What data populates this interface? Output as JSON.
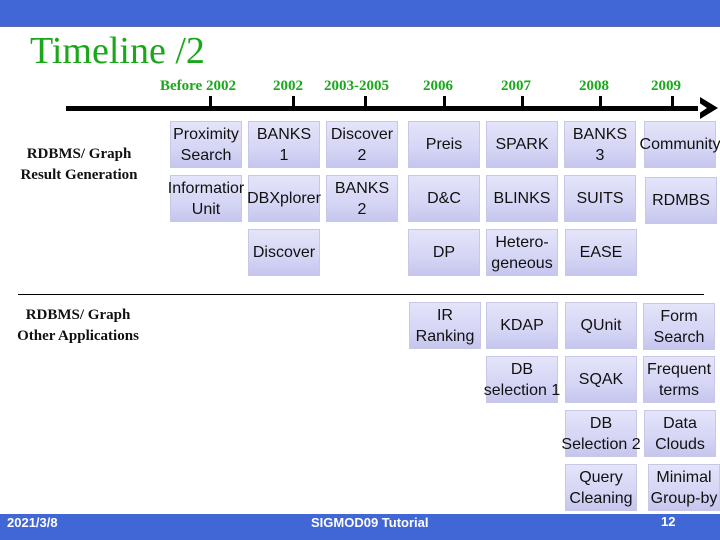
{
  "slide": {
    "title": "Timeline /2",
    "footer": {
      "date": "2021/3/8",
      "center": "SIGMOD09 Tutorial",
      "page_number": "12"
    },
    "colors": {
      "bar": "#4166d5",
      "title": "#1aa81a",
      "box": "#d5d5f5"
    }
  },
  "timeline": {
    "years": [
      "Before 2002",
      "2002",
      "2003-2005",
      "2006",
      "2007",
      "2008",
      "2009"
    ]
  },
  "sections": [
    {
      "label": "RDBMS/ Graph\nResult Generation",
      "label_lines": [
        "RDBMS/ Graph",
        "Result Generation"
      ],
      "boxes": [
        "Proximity\nSearch",
        "BANKS\n1",
        "Discover\n2",
        "Preis",
        "SPARK",
        "BANKS\n3",
        "Community",
        "Informatior\nUnit",
        "DBXplorer",
        "BANKS\n2",
        "D&C",
        "BLINKS",
        "SUITS",
        "RDMBS",
        "Discover",
        "DP",
        "Hetero-\ngeneous",
        "EASE"
      ]
    },
    {
      "label": "RDBMS/ Graph\nOther Applications",
      "label_lines": [
        "RDBMS/ Graph",
        "Other Applications"
      ],
      "boxes": [
        "IR\nRanking",
        "KDAP",
        "QUnit",
        "Form\nSearch",
        "DB\nselection 1",
        "SQAK",
        "Frequent\nterms",
        "DB\nSelection 2",
        "Data\nClouds",
        "Query\nCleaning",
        "Minimal\nGroup-by"
      ]
    }
  ]
}
